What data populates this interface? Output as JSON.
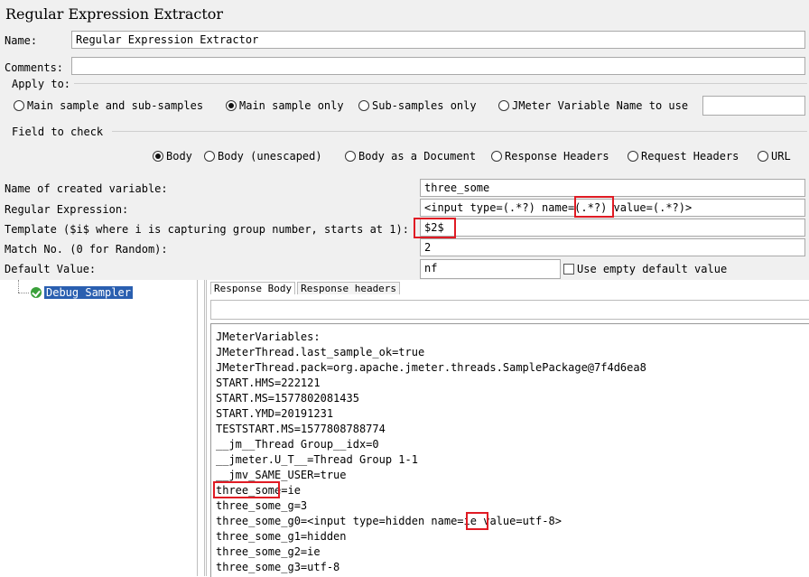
{
  "panel": {
    "title": "Regular Expression Extractor",
    "name_label": "Name:",
    "name_value": "Regular Expression Extractor",
    "comments_label": "Comments:",
    "comments_value": "",
    "apply_to": {
      "legend": "Apply to:",
      "options": [
        "Main sample and sub-samples",
        "Main sample only",
        "Sub-samples only",
        "JMeter Variable Name to use"
      ],
      "selected": "Main sample only",
      "variable_value": ""
    },
    "field_to_check": {
      "legend": "Field to check",
      "options": [
        "Body",
        "Body (unescaped)",
        "Body as a Document",
        "Response Headers",
        "Request Headers",
        "URL"
      ],
      "selected": "Body"
    },
    "created_variable_label": "Name of created variable:",
    "created_variable_value": "three_some",
    "regex_label": "Regular Expression:",
    "regex_value": "<input type=(.*?) name=(.*?) value=(.*?)>",
    "regex_part1": "<input type=(.*?) name=",
    "regex_part2": "(.*?)",
    "regex_part3": " value=(.*?)>",
    "template_label": "Template ($i$ where i is capturing group number, starts at 1):",
    "template_value": "$2$",
    "match_label": "Match No. (0 for Random):",
    "match_value": "2",
    "default_label": "Default Value:",
    "default_value": "nf",
    "use_empty_label": "Use empty default value"
  },
  "tree": {
    "node_label": "Debug Sampler"
  },
  "results": {
    "tabs": [
      "Response Body",
      "Response headers"
    ],
    "lines": [
      "JMeterVariables:",
      "JMeterThread.last_sample_ok=true",
      "JMeterThread.pack=org.apache.jmeter.threads.SamplePackage@7f4d6ea8",
      "START.HMS=222121",
      "START.MS=1577802081435",
      "START.YMD=20191231",
      "TESTSTART.MS=1577808788774",
      "__jm__Thread Group__idx=0",
      "__jmeter.U_T__=Thread Group 1-1",
      "__jmv_SAME_USER=true",
      "three_some=ie",
      "three_some_g=3",
      "three_some_g0=<input type=hidden name=ie value=utf-8>",
      "three_some_g1=hidden",
      "three_some_g2=ie",
      "three_some_g3=utf-8"
    ],
    "g0_part1": "three_some_g0=<input type=hidden name=",
    "g0_part2": "ie",
    "g0_part3": " value=utf-8>"
  }
}
